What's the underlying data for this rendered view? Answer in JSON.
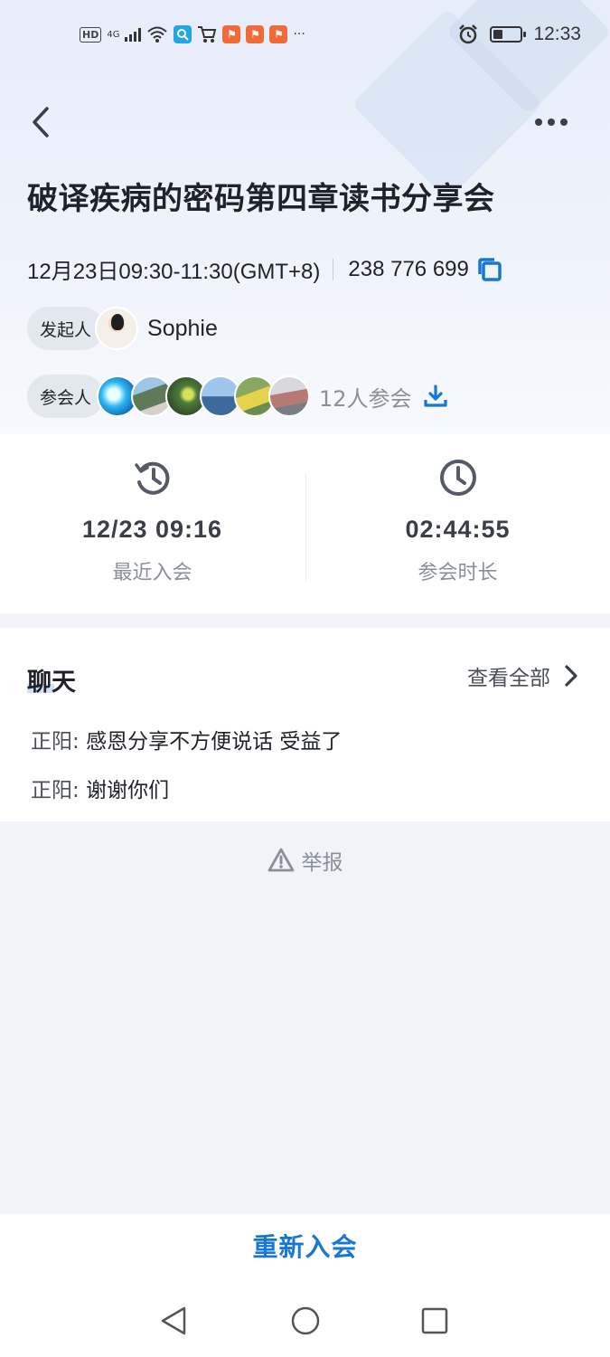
{
  "status_bar": {
    "network_badge": "HD",
    "signal_label": "4G",
    "more_indicator": "···",
    "time": "12:33"
  },
  "meeting": {
    "title": "破译疾病的密码第四章读书分享会",
    "time_range": "12月23日09:30-11:30(GMT+8)",
    "meeting_id": "238 776 699"
  },
  "initiator": {
    "label": "发起人",
    "name": "Sophie"
  },
  "attendees": {
    "label": "参会人",
    "count_text": "12人参会"
  },
  "stats": {
    "last_join_value": "12/23 09:16",
    "last_join_label": "最近入会",
    "duration_value": "02:44:55",
    "duration_label": "参会时长"
  },
  "chat": {
    "title": "聊天",
    "view_all": "查看全部",
    "messages": [
      {
        "sender": "正阳:",
        "text": "感恩分享不方便说话 受益了"
      },
      {
        "sender": "正阳:",
        "text": "谢谢你们"
      }
    ]
  },
  "report_label": "举报",
  "rejoin_label": "重新入会",
  "colors": {
    "accent": "#1677d6",
    "background": "#f1f3f8",
    "text_primary": "#1f2329",
    "text_secondary": "#8a909b"
  }
}
